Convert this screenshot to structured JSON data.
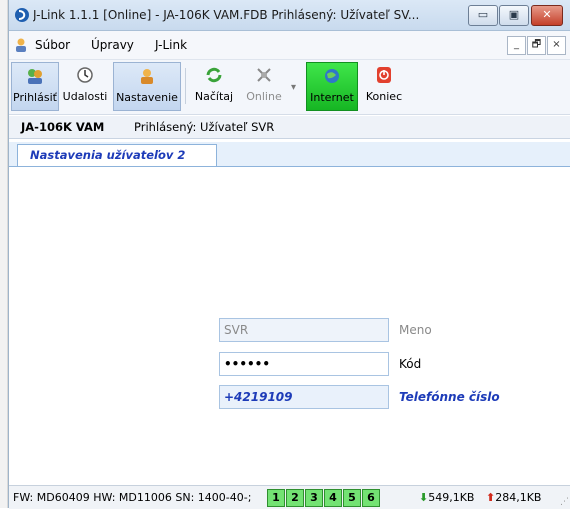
{
  "window": {
    "title": "J-Link 1.1.1 [Online] - JA-106K VAM.FDB Prihlásený: Užívateľ SV...",
    "buttons": [
      "▭",
      "▣",
      "✕"
    ]
  },
  "menu": {
    "items": [
      "Súbor",
      "Úpravy",
      "J-Link"
    ],
    "mdi": [
      "_",
      "🗗",
      "×"
    ]
  },
  "toolbar": {
    "items": [
      {
        "label": "Prihlásiť",
        "icon": "login-icon"
      },
      {
        "label": "Udalosti",
        "icon": "clock-icon"
      },
      {
        "label": "Nastavenie",
        "icon": "settings-icon"
      },
      {
        "label": "Načítaj",
        "icon": "refresh-icon"
      },
      {
        "label": "Online",
        "icon": "satellite-icon"
      },
      {
        "label": "Internet",
        "icon": "globe-icon"
      },
      {
        "label": "Koniec",
        "icon": "power-icon"
      }
    ],
    "dropdown": "▾"
  },
  "info": {
    "device": "JA-106K VAM",
    "user": "Prihlásený: Užívateľ SVR"
  },
  "tab": {
    "title": "Nastavenia užívateľov 2"
  },
  "form": {
    "name_value": "SVR",
    "name_label": "Meno",
    "code_value": "••••••",
    "code_label": "Kód",
    "phone_value": "+4219109",
    "phone_label": "Telefónne číslo"
  },
  "status": {
    "text": "FW: MD60409 HW: MD11006 SN: 1400-40-;",
    "boxes": [
      "1",
      "2",
      "3",
      "4",
      "5",
      "6"
    ],
    "down": "549,1KB",
    "up": "284,1KB",
    "down_arrow": "⬇",
    "up_arrow": "⬆"
  },
  "colors": {
    "accent": "#1d3bb8",
    "internet_green": "#16b623",
    "status_green": "#73e273"
  }
}
